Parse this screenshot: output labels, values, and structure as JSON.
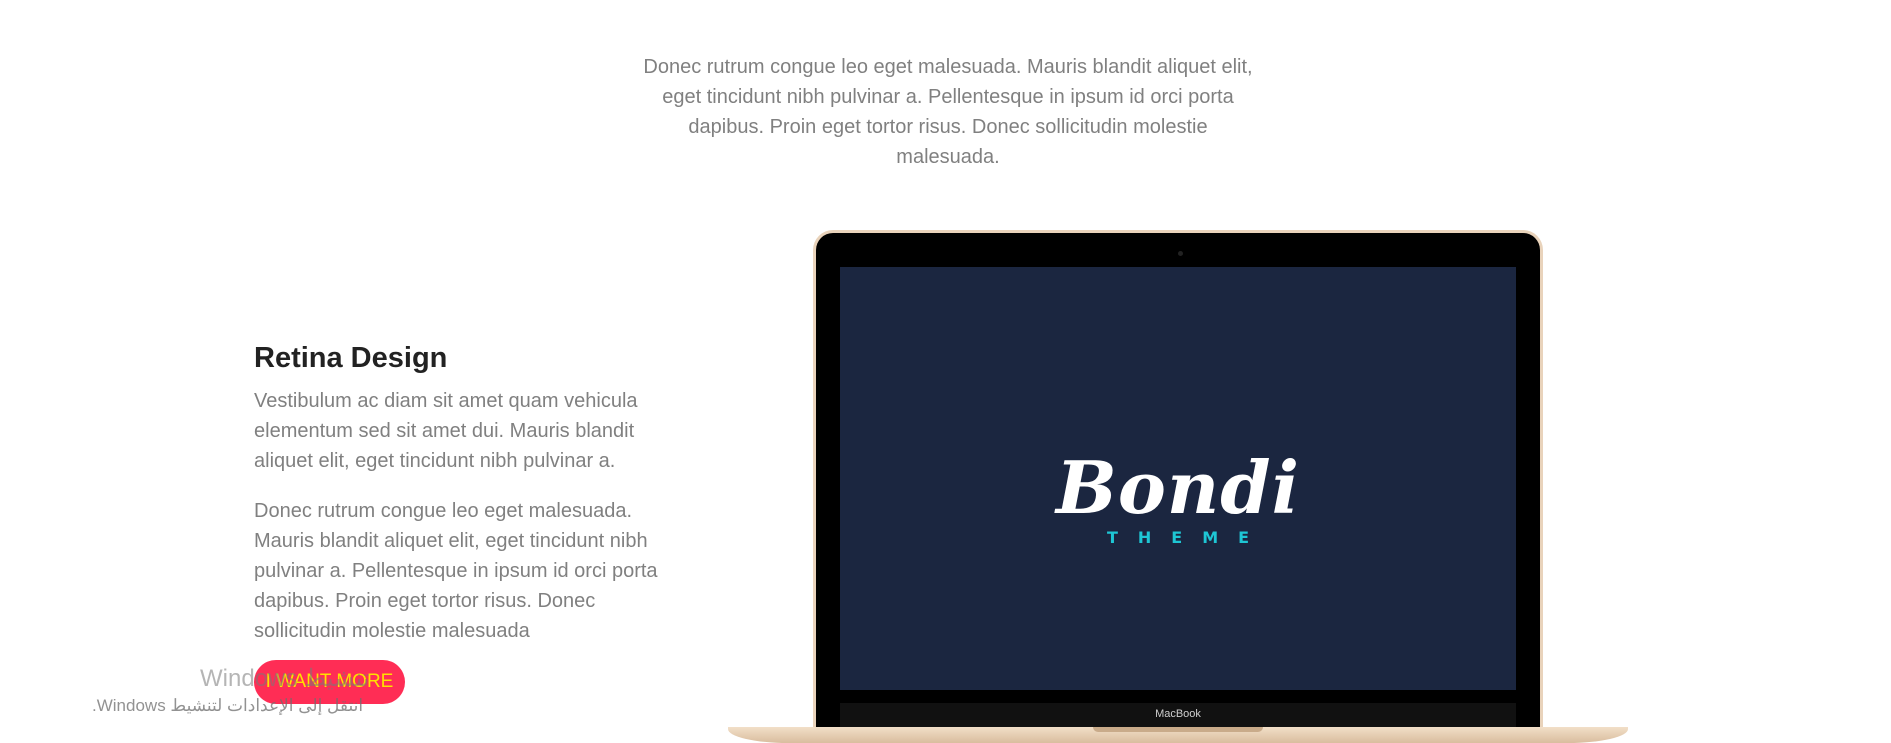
{
  "intro": {
    "text": "Donec rutrum congue leo eget malesuada. Mauris blandit aliquet elit, eget tincidunt nibh pulvinar a. Pellentesque in ipsum id orci porta dapibus. Proin eget tortor risus. Donec sollicitudin molestie malesuada."
  },
  "feature": {
    "title": "Retina Design",
    "paragraph1": "Vestibulum ac diam sit amet quam vehicula elementum sed sit amet dui. Mauris blandit aliquet elit, eget tincidunt nibh pulvinar a.",
    "paragraph2": "Donec rutrum congue leo eget malesuada. Mauris blandit aliquet elit, eget tincidunt nibh pulvinar a. Pellentesque in ipsum id orci porta dapibus. Proin eget tortor risus. Donec sollicitudin molestie malesuada",
    "button_label": "I WANT MORE"
  },
  "laptop": {
    "logo_text": "Bondi",
    "logo_subtext": "THEME",
    "brand_label": "MacBook"
  },
  "watermark": {
    "title": "Windows تنشيط",
    "subtitle": "انتقل إلى الإعدادات لتنشيط Windows."
  },
  "colors": {
    "button_bg": "#ff2d55",
    "button_text": "#ffe000",
    "screen_bg": "#1b2640",
    "logo_accent": "#1ec6d4"
  }
}
